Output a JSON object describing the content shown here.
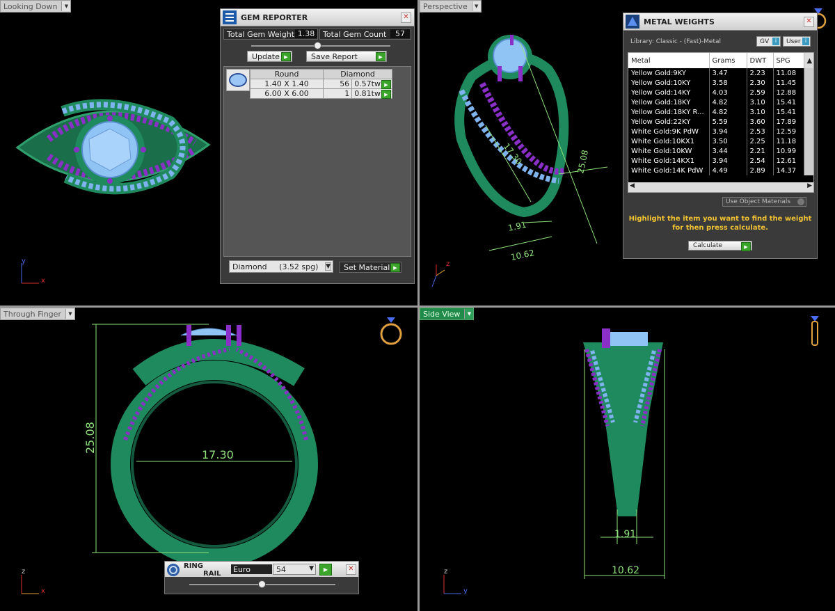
{
  "viewports": {
    "top_left": {
      "label": "Looking Down"
    },
    "top_right": {
      "label": "Perspective"
    },
    "bottom_left": {
      "label": "Through Finger"
    },
    "bottom_right": {
      "label": "Side View"
    }
  },
  "axes": {
    "x": "x",
    "y": "y",
    "z": "z"
  },
  "gem_reporter": {
    "title": "GEM REPORTER",
    "total_weight_label": "Total Gem Weight",
    "total_weight_value": "1.38",
    "total_count_label": "Total Gem Count",
    "total_count_value": "57",
    "update_label": "Update",
    "save_report_label": "Save Report",
    "table_headers": [
      "Round",
      "Diamond"
    ],
    "rows": [
      {
        "size": "1.40 X 1.40",
        "count": "56",
        "weight": "0.57tw"
      },
      {
        "size": "6.00 X 6.00",
        "count": "1",
        "weight": "0.81tw"
      }
    ],
    "material_select": "Diamond     (3.52 spg)",
    "set_material_label": "Set Material"
  },
  "metal_weights": {
    "title": "METAL WEIGHTS",
    "library": "Library: Classic - (Fast)-Metal",
    "gv_label": "GV",
    "user_label": "User",
    "columns": [
      "Metal",
      "Grams",
      "DWT",
      "SPG"
    ],
    "rows": [
      [
        "Yellow Gold:9KY",
        "3.47",
        "2.23",
        "11.08"
      ],
      [
        "Yellow Gold:10KY",
        "3.58",
        "2.30",
        "11.45"
      ],
      [
        "Yellow Gold:14KY",
        "4.03",
        "2.59",
        "12.88"
      ],
      [
        "Yellow Gold:18KY",
        "4.82",
        "3.10",
        "15.41"
      ],
      [
        "Yellow Gold:18KY R...",
        "4.82",
        "3.10",
        "15.41"
      ],
      [
        "Yellow Gold:22KY",
        "5.59",
        "3.60",
        "17.89"
      ],
      [
        "White Gold:9K PdW",
        "3.94",
        "2.53",
        "12.59"
      ],
      [
        "White Gold:10KX1",
        "3.50",
        "2.25",
        "11.18"
      ],
      [
        "White Gold:10KW",
        "3.44",
        "2.21",
        "10.99"
      ],
      [
        "White Gold:14KX1",
        "3.94",
        "2.54",
        "12.61"
      ],
      [
        "White Gold:14K PdW",
        "4.49",
        "2.89",
        "14.37"
      ]
    ],
    "use_object_materials": "Use Object Materials",
    "hint_line1": "Highlight the item you want to find the weight",
    "hint_line2": "for then press calculate.",
    "calculate_label": "Calculate"
  },
  "ring_rail": {
    "title_line1": "RING",
    "title_line2": "RAIL",
    "standard": "Euro",
    "size": "54"
  },
  "dimensions": {
    "width": "17.30",
    "height": "25.08",
    "band": "1.91",
    "depth": "10.62"
  },
  "colors": {
    "metal": "#1f8a5e",
    "stone": "#7fb3f0",
    "prong": "#8a2fc7",
    "dimension": "#8fe37a"
  }
}
